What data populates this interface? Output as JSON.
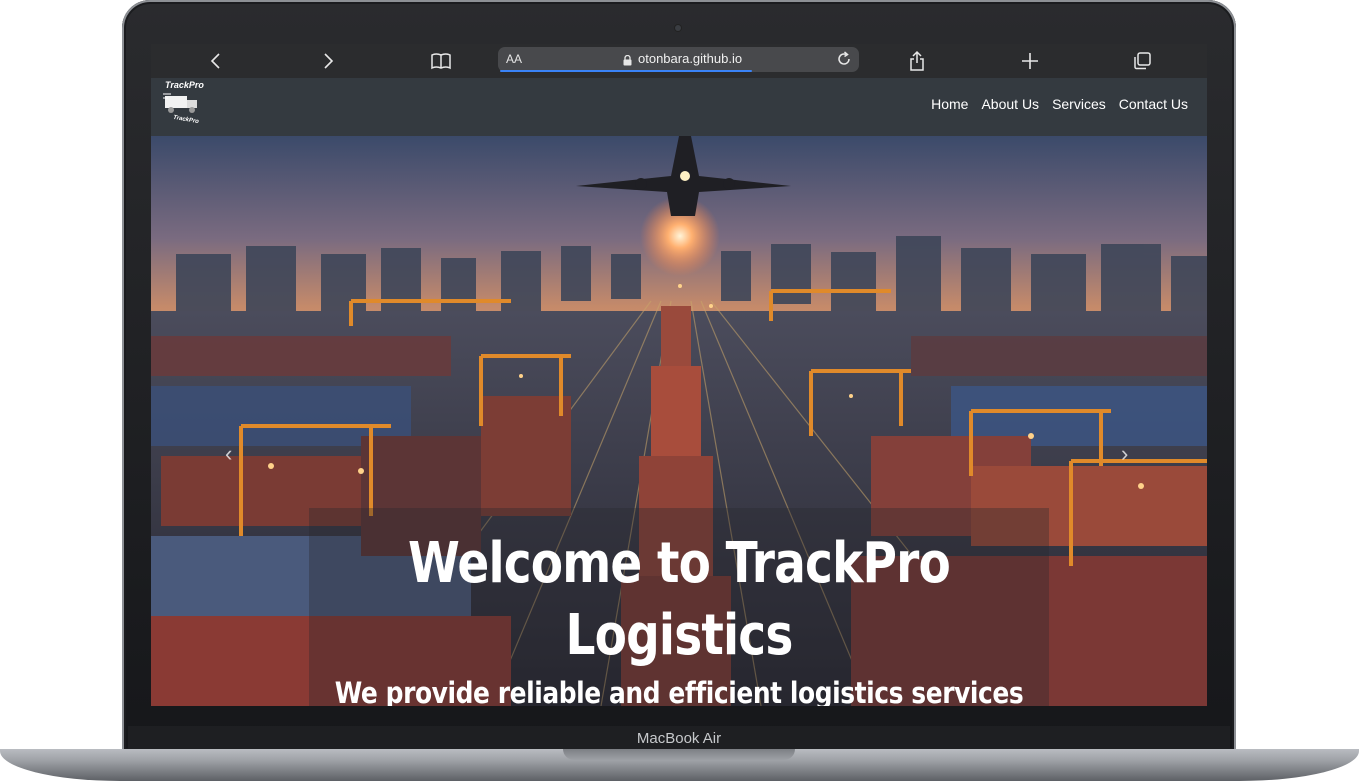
{
  "browser": {
    "text_size_label": "AA",
    "url": "otonbara.github.io",
    "icons": [
      "back-icon",
      "forward-icon",
      "bookmarks-icon",
      "lock-icon",
      "reload-icon",
      "share-icon",
      "new-tab-icon",
      "tabs-icon"
    ],
    "accent_color": "#3a83f7"
  },
  "site": {
    "logo_text": "TrackPro",
    "logo_subtext": "TrackPro",
    "nav": [
      "Home",
      "About Us",
      "Services",
      "Contact Us"
    ],
    "nav_bg": "#343a40"
  },
  "hero": {
    "title_line1": "Welcome to TrackPro",
    "title_line2": "Logistics",
    "subtitle": "We provide reliable and efficient logistics services",
    "prev_arrow": "‹",
    "next_arrow": "›"
  },
  "device": {
    "label": "MacBook Air"
  }
}
